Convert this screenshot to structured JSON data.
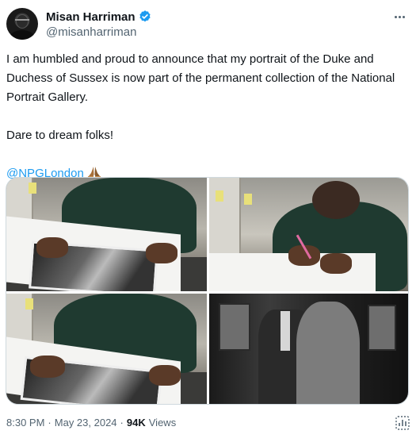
{
  "author": {
    "display_name": "Misan Harriman",
    "handle": "@misanharriman",
    "verified": true
  },
  "tweet": {
    "paragraph1": "I am humbled and proud to announce that my portrait of the Duke and Duchess of Sussex is now part of the permanent collection of the National Portrait Gallery.",
    "paragraph2": "Dare to dream folks!",
    "mention": "@NPGLondon",
    "emoji": "folded-hands-icon"
  },
  "media": {
    "photos": [
      "photo-signing-print",
      "photo-signing-paper",
      "photo-holding-print",
      "photo-portrait-bw"
    ]
  },
  "meta": {
    "time": "8:30 PM",
    "separator1": "·",
    "date": "May 23, 2024",
    "separator2": "·",
    "views_count": "94K",
    "views_label": "Views"
  },
  "colors": {
    "accent": "#1d9bf0",
    "text": "#0f1419",
    "secondary": "#536471"
  }
}
